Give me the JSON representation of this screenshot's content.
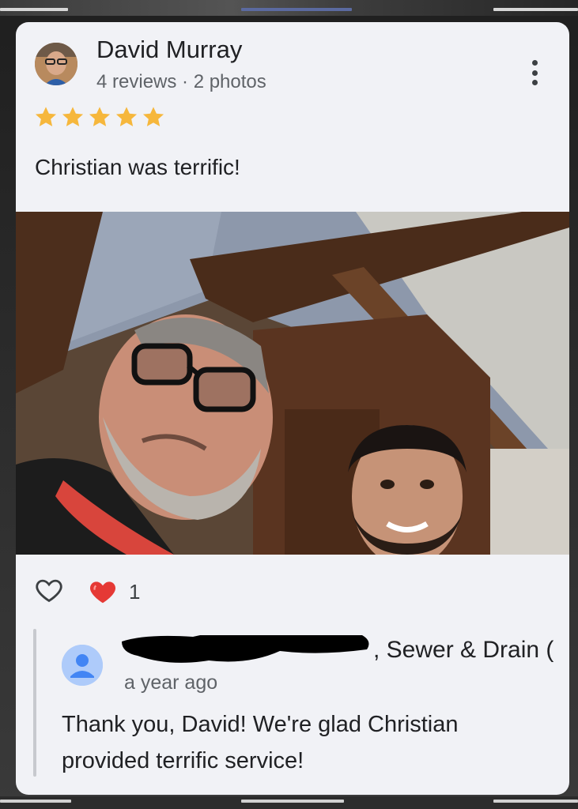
{
  "review": {
    "reviewer_name": "David Murray",
    "reviewer_meta": "4 reviews · 2 photos",
    "rating": 5,
    "rating_max": 5,
    "text": "Christian was terrific!"
  },
  "reactions": {
    "like_icon": "heart-outline-icon",
    "reaction_icon": "red-heart-icon",
    "count": "1"
  },
  "owner_reply": {
    "name_visible": ", Sewer & Drain (",
    "time": "a year ago",
    "text": "Thank you, David! We're glad Christian provided terrific service!"
  },
  "colors": {
    "card_background": "#f1f2f6",
    "star": "#f6b73c",
    "heart": "#e53935",
    "owner_avatar": "#aecbfa"
  }
}
